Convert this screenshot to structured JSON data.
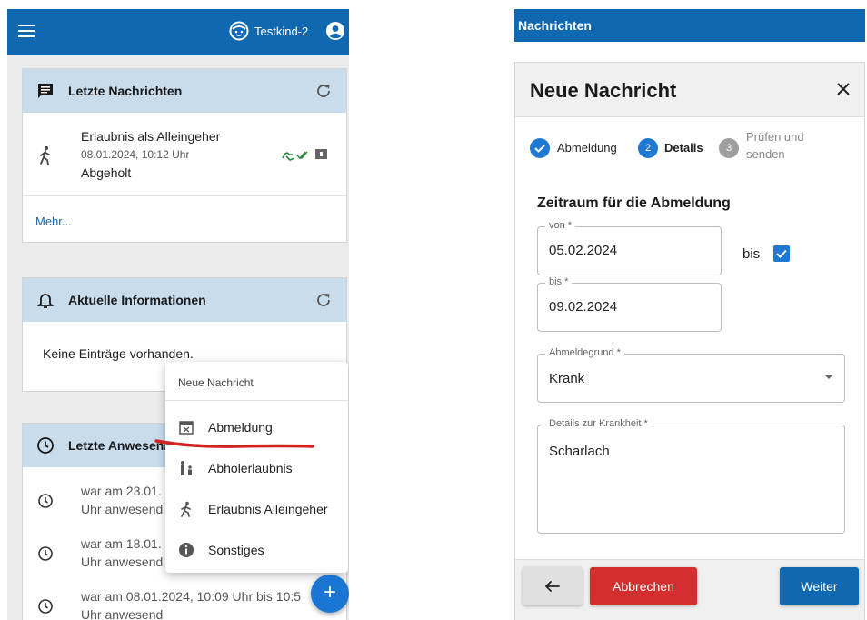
{
  "left": {
    "topbar": {
      "child_name": "Testkind-2"
    },
    "messages_card": {
      "title": "Letzte Nachrichten",
      "message": {
        "title": "Erlaubnis als Alleingeher",
        "date": "08.01.2024, 10:12 Uhr",
        "status": "Abgeholt"
      },
      "more_link": "Mehr..."
    },
    "info_card": {
      "title": "Aktuelle Informationen",
      "empty_text": "Keine Einträge vorhanden."
    },
    "attendance_card": {
      "title": "Letzte Anwesenheit",
      "rows": [
        {
          "line1": "war am 23.01.",
          "line2": "Uhr anwesend"
        },
        {
          "line1": "war am 18.01.",
          "line2": "Uhr anwesend"
        },
        {
          "line1": "war am 08.01.2024, 10:09 Uhr bis 10:5",
          "line2": "Uhr anwesend"
        }
      ]
    },
    "new_message_menu": {
      "title": "Neue Nachricht",
      "items": [
        {
          "label": "Abmeldung",
          "icon": "calendar-cancel-icon"
        },
        {
          "label": "Abholerlaubnis",
          "icon": "adult-child-icon"
        },
        {
          "label": "Erlaubnis Alleingeher",
          "icon": "walking-person-icon"
        },
        {
          "label": "Sonstiges",
          "icon": "info-icon"
        }
      ]
    },
    "fab_label": "+"
  },
  "right": {
    "app_bar_title": "Nachrichten",
    "dialog": {
      "title": "Neue Nachricht",
      "close_icon": "close-icon",
      "steps": [
        {
          "number": "1",
          "label": "Abmeldung",
          "state": "completed"
        },
        {
          "number": "2",
          "label": "Details",
          "state": "active"
        },
        {
          "number": "3",
          "label_line1": "Prüfen und",
          "label_line2": "senden",
          "state": "pending"
        }
      ],
      "section_title": "Zeitraum für die Abmeldung",
      "from_field": {
        "label": "von *",
        "value": "05.02.2024"
      },
      "range_toggle": {
        "label": "bis",
        "checked": true
      },
      "to_field": {
        "label": "bis *",
        "value": "09.02.2024"
      },
      "reason_field": {
        "label": "Abmeldegrund *",
        "value": "Krank"
      },
      "details_field": {
        "label": "Details zur Krankheit *",
        "value": "Scharlach"
      },
      "buttons": {
        "back": "←",
        "cancel": "Abbrechen",
        "next": "Weiter"
      }
    }
  },
  "colors": {
    "primary": "#0f68b0",
    "card_header": "#c8dcec",
    "cancel": "#d32f2f",
    "step_done": "#1f78d1",
    "step_pending": "#9e9e9e",
    "annotation": "#d32222"
  }
}
